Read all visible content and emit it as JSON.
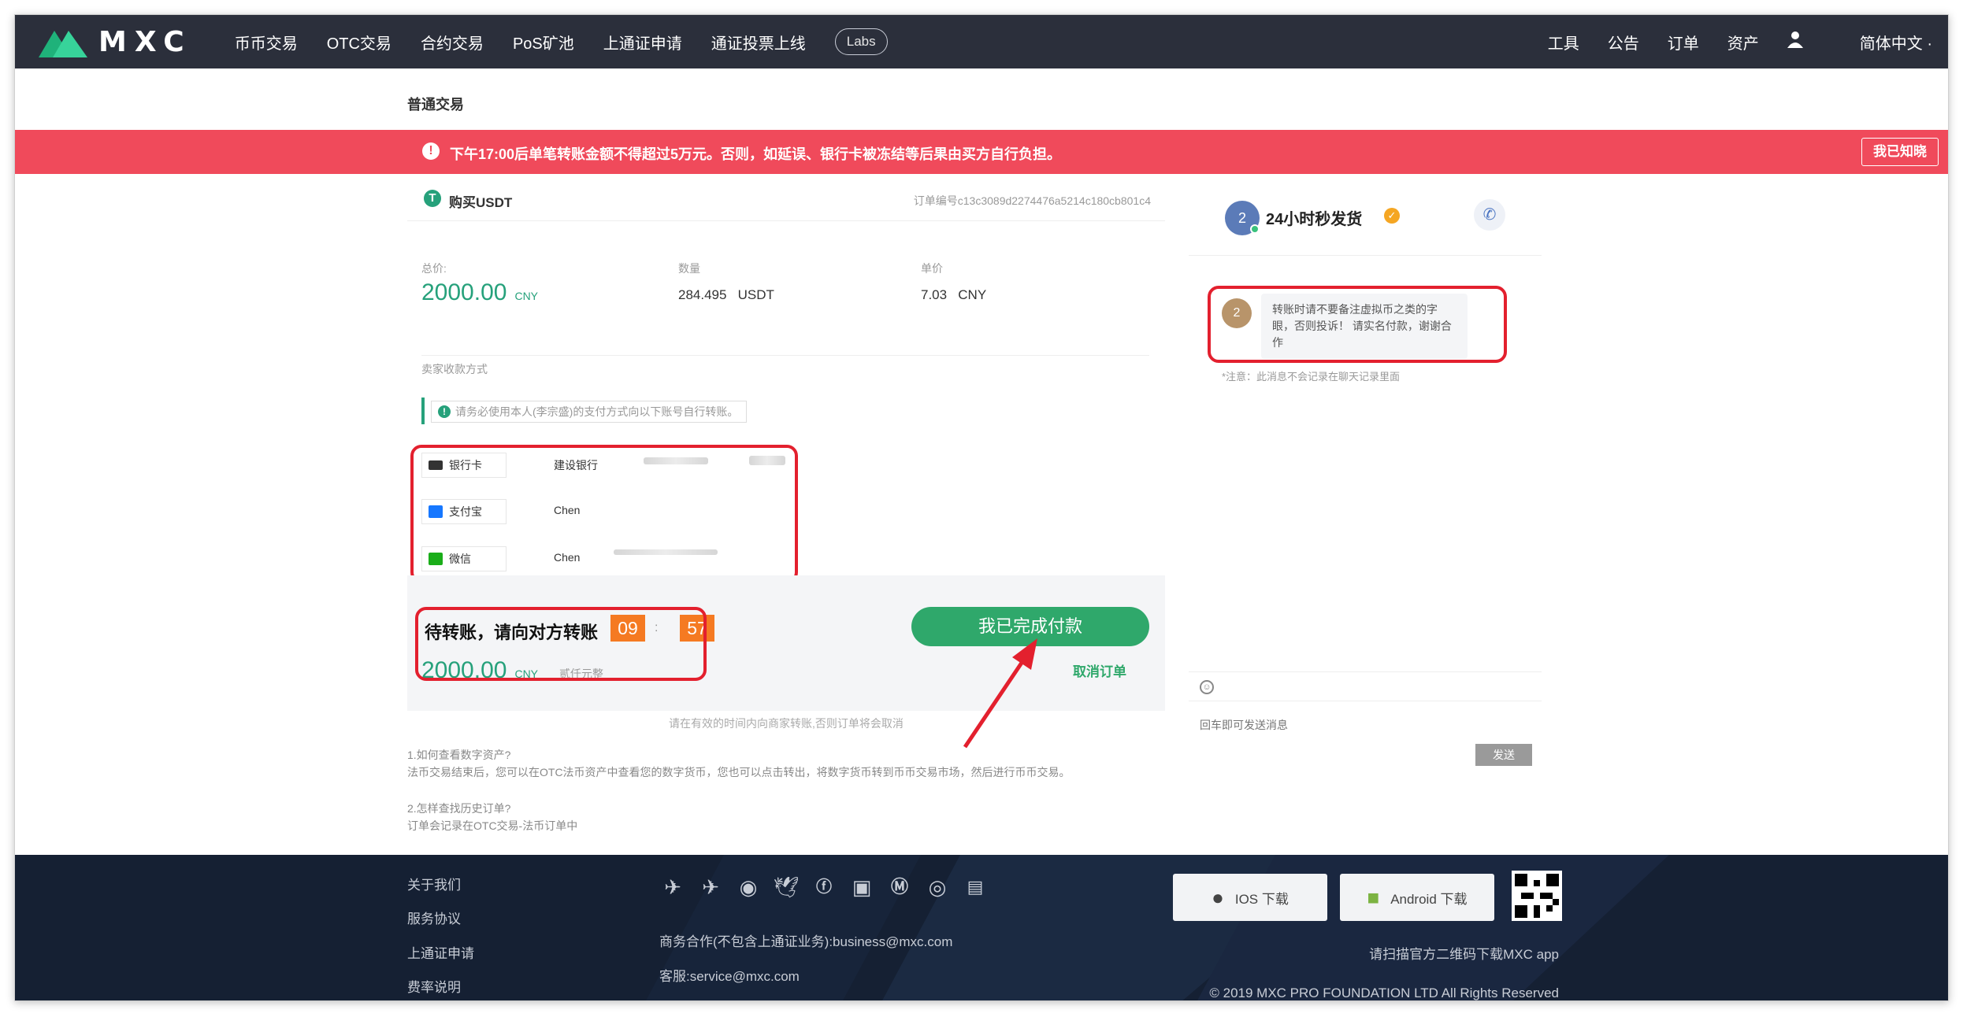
{
  "header": {
    "logo_text": "MXC",
    "nav": [
      "币币交易",
      "OTC交易",
      "合约交易",
      "PoS矿池",
      "上通证申请",
      "通证投票上线"
    ],
    "labs": "Labs",
    "right": [
      "工具",
      "公告",
      "订单",
      "资产"
    ],
    "language": "简体中文",
    "language_caret": "·"
  },
  "subheader": {
    "title": "普通交易"
  },
  "alert": {
    "icon": "!",
    "message": "下午17:00后单笔转账金额不得超过5万元。否则，如延误、银行卡被冻结等后果由买方自行负担。",
    "ack_label": "我已知晓"
  },
  "order": {
    "tether_icon": "T",
    "title": "购买USDT",
    "order_no": "订单编号c13c3089d2274476a5214c180cb801c4",
    "total_label": "总价:",
    "total_value": "2000.00",
    "total_unit": "CNY",
    "qty_label": "数量",
    "qty_value": "284.495",
    "qty_unit": "USDT",
    "price_label": "单价",
    "price_value": "7.03",
    "price_unit": "CNY",
    "payment_label": "卖家收款方式",
    "notice_icon": "!",
    "notice": "请务必使用本人(李宗盛)的支付方式向以下账号自行转账。",
    "payments": [
      {
        "type": "银行卡",
        "name": "建设银行"
      },
      {
        "type": "支付宝",
        "name": "Chen"
      },
      {
        "type": "微信",
        "name": "Chen"
      }
    ]
  },
  "pending": {
    "title": "待转账，请向对方转账",
    "minutes": "09",
    "colon": ":",
    "seconds": "57",
    "amount": "2000.00",
    "amount_unit": "CNY",
    "amount_words": "贰仟元整",
    "paid_button": "我已完成付款",
    "cancel": "取消订单",
    "tip": "请在有效的时间内向商家转账,否则订单将会取消"
  },
  "faq": [
    {
      "q": "1.如何查看数字资产?",
      "a": "法币交易结束后，您可以在OTC法币资产中查看您的数字货币，您也可以点击转出，将数字货币转到币币交易市场，然后进行币币交易。"
    },
    {
      "q": "2.怎样查找历史订单?",
      "a": "订单会记录在OTC交易-法币订单中"
    }
  ],
  "chat": {
    "avatar": "2",
    "name": "24小时秒发货",
    "badge": "✓",
    "phone_icon": "✆",
    "message_avatar": "2",
    "message": "转账时请不要备注虚拟币之类的字眼，否则投诉！ 请实名付款，谢谢合作",
    "note": "*注意：此消息不会记录在聊天记录里面",
    "emoji_icon": "☺",
    "input_placeholder": "回车即可发送消息",
    "send": "发送"
  },
  "footer": {
    "links": [
      "关于我们",
      "服务协议",
      "上通证申请",
      "费率说明"
    ],
    "business": "商务合作(不包含上通证业务):business@mxc.com",
    "service": "客服:service@mxc.com",
    "ios": "IOS 下载",
    "android": "Android 下载",
    "scan": "请扫描官方二维码下载MXC app",
    "copyright": "© 2019 MXC PRO FOUNDATION LTD All Rights Reserved"
  },
  "colors": {
    "accent": "#26a17b",
    "alert": "#f04a5b",
    "countdown": "#f57a22",
    "header": "#2b2f3b",
    "footer": "#152033"
  }
}
